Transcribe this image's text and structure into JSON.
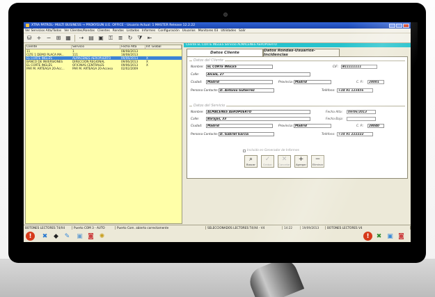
{
  "window": {
    "title": "XTRA PATROL- MULTI BUSINESS → PROKYGUN U.E. OFFICE - Usuario Actual: 1 MASTER Release 12.2.22"
  },
  "menu": [
    "Ver Servicios Alta/Todos",
    "Ver Clientes/Rondas",
    "Clientes",
    "Rondas",
    "Listados",
    "Informes",
    "Configuración",
    "Usuarios",
    "Monitores 03",
    "Utilidades",
    "Salir"
  ],
  "toolbar_icons": [
    "disk-icon",
    "plus-icon",
    "minus-icon",
    "grid-icon",
    "table-icon",
    "link-icon",
    "folder-icon",
    "photo-icon",
    "key-icon",
    "stack-icon",
    "refresh-icon",
    "filter-icon",
    "exit-icon"
  ],
  "list": {
    "headers": [
      "Cliente",
      "Servicio",
      "Fecha Alta",
      "Inf. Global"
    ],
    "rows": [
      {
        "cliente": "11",
        "servicio": "1",
        "fecha": "08/08/2013",
        "inf": ""
      },
      {
        "cliente": "CLTE 1 DEMO PLACA MA...",
        "servicio": "111",
        "fecha": "18/08/2013",
        "inf": ""
      },
      {
        "cliente": "EL CORTE INGLÉS",
        "servicio": "ALMACENES AEROPUERTO",
        "fecha": "09/06/2013",
        "inf": "X",
        "selected": true
      },
      {
        "cliente": "BANCO DE INVERSIONES",
        "servicio": "DIRECCIÓN REGIONAL",
        "fecha": "09/06/2013",
        "inf": "X"
      },
      {
        "cliente": "EL CORTE INGLÉS",
        "servicio": "OFICINAS CENTRALES",
        "fecha": "09/06/2013",
        "inf": "X"
      },
      {
        "cliente": "PAR M. ARTEAGA 20-Acc...",
        "servicio": "PAR M. ARTEAGA 20-Acceso",
        "fecha": "02/02/2009",
        "inf": ""
      }
    ]
  },
  "detail": {
    "header": "Cliente EL CORTE INGLÉS Servicio ALMACENES AEROPUERTO",
    "tabs": [
      "Datos Cliente",
      "Datos Rondas-Usuarios-Incidencias"
    ],
    "cliente": {
      "title": "Datos del Cliente",
      "nombre_label": "Nombre:",
      "nombre": "EL CORTE INGLÉS",
      "cif_label": "CIF:",
      "cif": "B11111111",
      "calle_label": "Calle:",
      "calle": "Alcalá, 27",
      "ciudad_label": "Ciudad:",
      "ciudad": "Madrid",
      "provincia_label": "Provincia:",
      "provincia": "Madrid",
      "cp_label": "C. P.:",
      "cp": "28001",
      "contacto_label": "Persona Contacto:",
      "contacto": "D. Antonio Gutierrez",
      "telefono_label": "Teléfono:",
      "telefono": "+34 91 123456"
    },
    "servicio": {
      "title": "Datos del Servicio",
      "nombre_label": "Nombre:",
      "nombre": "ALMACENES AEROPUERTO",
      "fecha_alta_label": "Fecha Alta:",
      "fecha_alta": "09/06/2013",
      "calle_label": "Calle:",
      "calle": "Barajas, 33",
      "fecha_baja_label": "Fecha Baja:",
      "fecha_baja": "",
      "ciudad_label": "Ciudad:",
      "ciudad": "Madrid",
      "provincia_label": "Provincia:",
      "provincia": "Madrid",
      "cp_label": "C. P.:",
      "cp": "28040",
      "contacto_label": "Persona Contacto:",
      "contacto": "D. Gabriel Garcia",
      "telefono_label": "Teléfono:",
      "telefono": "+34 91 222222"
    },
    "checkbox_label": "Incluido en Generador de Informes",
    "buttons": [
      "Buscar",
      "Grabar",
      "Cancelar",
      "Agregar",
      "Eliminar"
    ]
  },
  "status": {
    "reader": "BOTONES LECTORES T4/X4",
    "port": "Puerto COM 3 - AUTO",
    "port_status": "Puerto Com. abierto correctamente",
    "selected": "SELECCIONADOS LECTORES T4/X4 - V4",
    "time": "14:22",
    "date": "19/09/2013",
    "right": "BOTONES LECTORES V4"
  }
}
